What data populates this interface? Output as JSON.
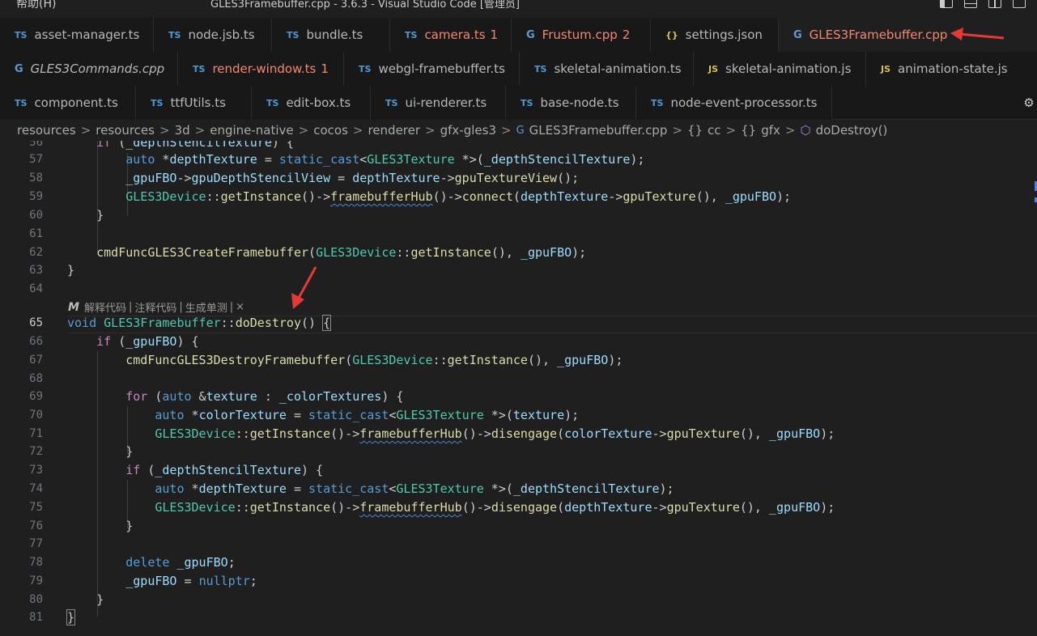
{
  "titlebar": {
    "menu_label": "帮助(H)",
    "window_title": "GLES3Framebuffer.cpp - 3.6.3 - Visual Studio Code [管理员]"
  },
  "tabs": {
    "row1": [
      {
        "label": "asset-manager.ts",
        "icon": "ts",
        "icon_text": "TS",
        "count": ""
      },
      {
        "label": "node.jsb.ts",
        "icon": "ts",
        "icon_text": "TS",
        "count": ""
      },
      {
        "label": "bundle.ts",
        "icon": "ts",
        "icon_text": "TS",
        "count": ""
      },
      {
        "label": "camera.ts",
        "icon": "ts",
        "icon_text": "TS",
        "count": "1"
      },
      {
        "label": "Frustum.cpp",
        "icon": "cpp",
        "icon_text": "G",
        "count": "2"
      },
      {
        "label": "settings.json",
        "icon": "json",
        "icon_text": "{}",
        "count": ""
      },
      {
        "label": "GLES3Framebuffer.cpp",
        "icon": "cpp",
        "icon_text": "G",
        "count": ""
      }
    ],
    "row2": [
      {
        "label": "GLES3Commands.cpp",
        "icon": "cpp",
        "icon_text": "G",
        "count": ""
      },
      {
        "label": "render-window.ts",
        "icon": "ts",
        "icon_text": "TS",
        "count": "1"
      },
      {
        "label": "webgl-framebuffer.ts",
        "icon": "ts",
        "icon_text": "TS",
        "count": ""
      },
      {
        "label": "skeletal-animation.ts",
        "icon": "ts",
        "icon_text": "TS",
        "count": ""
      },
      {
        "label": "skeletal-animation.js",
        "icon": "js",
        "icon_text": "JS",
        "count": ""
      },
      {
        "label": "animation-state.js",
        "icon": "js",
        "icon_text": "JS",
        "count": ""
      }
    ],
    "row3": [
      {
        "label": "component.ts",
        "icon": "ts",
        "icon_text": "TS",
        "count": ""
      },
      {
        "label": "ttfUtils.ts",
        "icon": "ts",
        "icon_text": "TS",
        "count": ""
      },
      {
        "label": "edit-box.ts",
        "icon": "ts",
        "icon_text": "TS",
        "count": ""
      },
      {
        "label": "ui-renderer.ts",
        "icon": "ts",
        "icon_text": "TS",
        "count": ""
      },
      {
        "label": "base-node.ts",
        "icon": "ts",
        "icon_text": "TS",
        "count": ""
      },
      {
        "label": "node-event-processor.ts",
        "icon": "ts",
        "icon_text": "TS",
        "count": ""
      }
    ]
  },
  "breadcrumb": {
    "items": [
      "resources",
      "resources",
      "3d",
      "engine-native",
      "cocos",
      "renderer",
      "gfx-gles3",
      "GLES3Framebuffer.cpp",
      "cc",
      "gfx",
      "doDestroy()"
    ],
    "separator": ">"
  },
  "codelens": {
    "items": [
      "解释代码",
      "注释代码",
      "生成单测"
    ],
    "separator": "|",
    "close": "×"
  },
  "editor": {
    "active_line": "65",
    "line_numbers": [
      "56",
      "57",
      "58",
      "59",
      "60",
      "61",
      "62",
      "63",
      "64",
      "65",
      "66",
      "67",
      "68",
      "69",
      "70",
      "71",
      "72",
      "73",
      "74",
      "75",
      "76",
      "77",
      "78",
      "79",
      "80",
      "81"
    ]
  },
  "annotation_colors": {
    "arrow": "#e53935",
    "accent": "#569cd6"
  }
}
